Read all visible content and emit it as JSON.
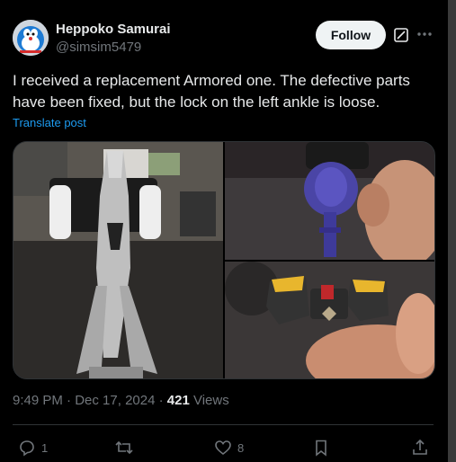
{
  "author": {
    "name": "Heppoko Samurai",
    "handle": "@simsim5479"
  },
  "follow_label": "Follow",
  "post_text": "I received a replacement Armored one. The defective parts have been fixed, but the lock on the left ankle is loose.",
  "translate_label": "Translate post",
  "meta": {
    "time": "9:49 PM",
    "dot1": " · ",
    "date": "Dec 17, 2024",
    "dot2": " · ",
    "views_count": "421",
    "views_label": " Views"
  },
  "actions": {
    "reply_count": "1",
    "like_count": "8"
  },
  "icons": [
    "grok-icon",
    "more-icon",
    "reply-icon",
    "repost-icon",
    "like-icon",
    "bookmark-icon",
    "share-icon"
  ],
  "colors": {
    "background": "#000000",
    "text": "#e7e9ea",
    "secondary": "#71767b",
    "link": "#1d9bf0",
    "follow_bg": "#eff3f4"
  }
}
